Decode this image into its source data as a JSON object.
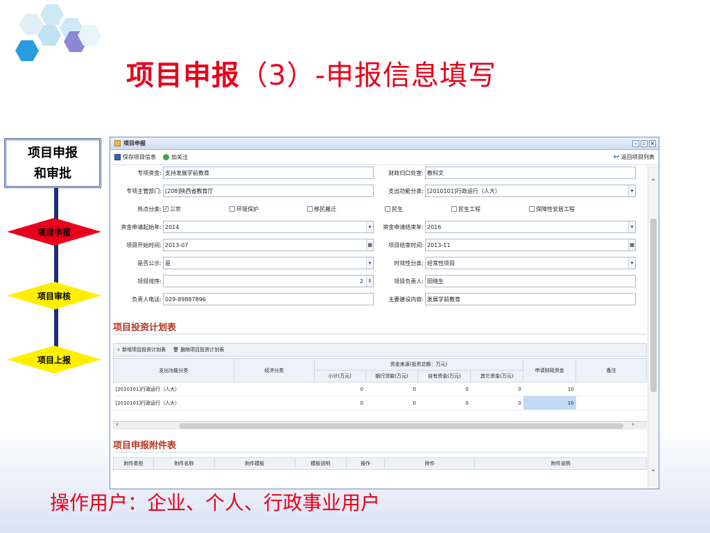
{
  "slide": {
    "title_bold": "项目申报",
    "title_rest": "（3）-申报信息填写",
    "subtitle": "操作用户：企业、个人、行政事业用户"
  },
  "flow": {
    "box_line1": "项目申报",
    "box_line2": "和审批",
    "steps": [
      "项目申报",
      "项目审核",
      "项目上报"
    ]
  },
  "window": {
    "title": "项目申报",
    "toolbar": {
      "save": "保存项目信息",
      "flow": "加关注",
      "back": "返回项目列表"
    },
    "form": {
      "zxzj_label": "专项资金:",
      "zxzj_value": "支持发展学前教育",
      "czgk_label": "财政归口处室:",
      "czgk_value": "教科文",
      "zgbm_label": "专项主管部门:",
      "zgbm_value": "[208]陕西省教育厅",
      "zcgn_label": "支出功能分类:",
      "zcgn_value": "[2010101]行政运行（人大）",
      "rdfl_label": "热点分类:",
      "checkboxes": [
        "三农",
        "环境保护",
        "移民搬迁",
        "民生",
        "民生工程",
        "保障性安居工程"
      ],
      "qsnf_label": "资金申请起始年:",
      "qsnf_value": "2014",
      "jsnf_label": "资金申请结束年:",
      "jsnf_value": "2016",
      "kssj_label": "项目开始时间:",
      "kssj_value": "2013-07",
      "jssj_label": "项目结束时间:",
      "jssj_value": "2013-11",
      "gs_label": "是否公示:",
      "gs_value": "是",
      "sx_label": "时效性分类:",
      "sx_value": "经常性项目",
      "px_label": "项目排序:",
      "px_value": "2",
      "fzr_label": "项目负责人:",
      "fzr_value": "田晓生",
      "dh_label": "负责人电话:",
      "dh_value": "029-89887896",
      "nr_label": "主要建设内容:",
      "nr_value": "发展学前教育"
    },
    "invest": {
      "section": "项目投资计划表",
      "add": "新增项目投资计划表",
      "del": "删除项目投资计划表",
      "headers": {
        "zcgn": "支出功能分类",
        "jjfl": "经济分类",
        "group": "资金来源(投资总额：万元)",
        "xj": "小计(万元)",
        "yhdk": "银行贷款(万元)",
        "zy": "自有资金(万元)",
        "qt": "其它资金(万元)",
        "sqcz": "申请财政资金",
        "bz": "备注"
      },
      "rows": [
        {
          "zcgn": "[2010101]行政运行（人大）",
          "xj": "0",
          "yhdk": "0",
          "zy": "0",
          "qt": "0",
          "sqcz": "10"
        },
        {
          "zcgn": "[2010101]行政运行（人大）",
          "xj": "0",
          "yhdk": "0",
          "zy": "0",
          "qt": "0",
          "sqcz": "10"
        }
      ]
    },
    "attach": {
      "section": "项目申报附件表",
      "headers": [
        "附件类型",
        "附件名称",
        "附件模板",
        "模板说明",
        "操作",
        "附件",
        "附件说明"
      ]
    }
  }
}
